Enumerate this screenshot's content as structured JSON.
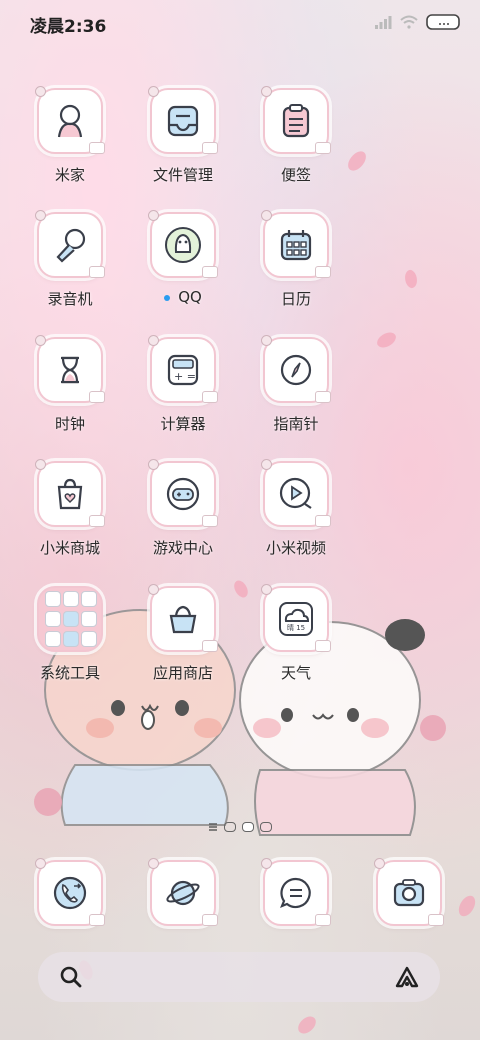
{
  "status_bar": {
    "time": "凌晨2:36"
  },
  "home": {
    "apps": [
      {
        "label": "米家"
      },
      {
        "label": "文件管理"
      },
      {
        "label": "便签"
      },
      {
        "label": "录音机"
      },
      {
        "label": "QQ"
      },
      {
        "label": "日历"
      },
      {
        "label": "时钟"
      },
      {
        "label": "计算器"
      },
      {
        "label": "指南针"
      },
      {
        "label": "小米商城"
      },
      {
        "label": "游戏中心"
      },
      {
        "label": "小米视频"
      },
      {
        "label": "系统工具"
      },
      {
        "label": "应用商店"
      },
      {
        "label": "天气"
      }
    ],
    "weather_icon_text": "晴 15"
  },
  "dock": {
    "apps": [
      "phone",
      "browser",
      "messages",
      "camera"
    ]
  },
  "icons": {
    "search": "search-icon",
    "assistant": "assistant-icon"
  },
  "colors": {
    "icon_border": "#f2c6d1",
    "icon_stroke": "#3a3f4a",
    "accent_pink": "#f6c9d3",
    "accent_blue": "#c8e3f5",
    "qq_dot": "#2a9cf0"
  }
}
